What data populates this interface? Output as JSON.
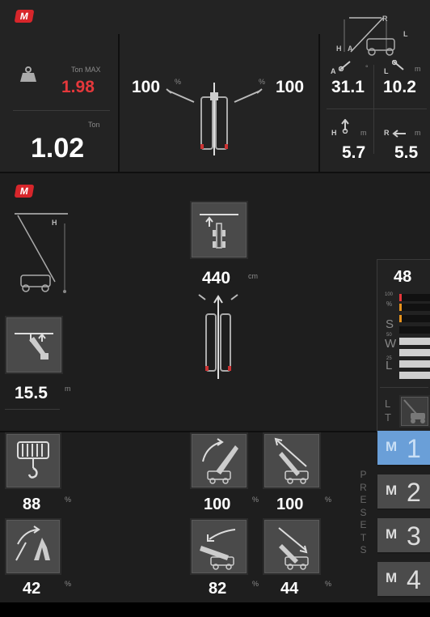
{
  "top": {
    "load": {
      "ton_max_label": "Ton MAX",
      "ton_max_value": "1.98",
      "ton_label": "Ton",
      "ton_value": "1.02"
    },
    "outriggers": {
      "left_value": "100",
      "right_value": "100",
      "unit": "%"
    },
    "boom": {
      "r_letter": "R",
      "l_letter": "L",
      "h_letter": "H",
      "a_letter": "A",
      "angle_label": "A",
      "angle_unit": "°",
      "angle_value": "31.1",
      "length_label": "L",
      "length_unit": "m",
      "length_value": "10.2",
      "height_label": "H",
      "height_unit": "m",
      "height_value": "5.7",
      "radius_label": "R",
      "radius_unit": "m",
      "radius_value": "5.5"
    }
  },
  "middle": {
    "h_letter": "H",
    "distance_value": "440",
    "distance_unit": "cm",
    "height_value": "15.5",
    "height_unit": "m",
    "gauge": {
      "value": "48",
      "percent_label": "%",
      "labels": [
        "S",
        "W",
        "L"
      ],
      "scale": [
        "100",
        "50",
        "25"
      ],
      "lt_label": [
        "L",
        "T"
      ]
    }
  },
  "bottom": {
    "winch_value": "88",
    "jib_value": "42",
    "boom_up_value": "100",
    "boom_out_value": "100",
    "boom_down_value": "82",
    "boom_in_value": "44",
    "unit": "%",
    "presets_label": "PRESETS",
    "presets_letters": [
      "P",
      "R",
      "E",
      "S",
      "E",
      "T",
      "S"
    ],
    "memory_buttons": [
      {
        "m": "M",
        "n": "1"
      },
      {
        "m": "M",
        "n": "2"
      },
      {
        "m": "M",
        "n": "3"
      },
      {
        "m": "M",
        "n": "4"
      }
    ]
  },
  "colors": {
    "accent_red": "#e5383b",
    "active_blue": "#6a9fd8",
    "warning_orange": "#e8931d"
  },
  "logo_letter": "M"
}
